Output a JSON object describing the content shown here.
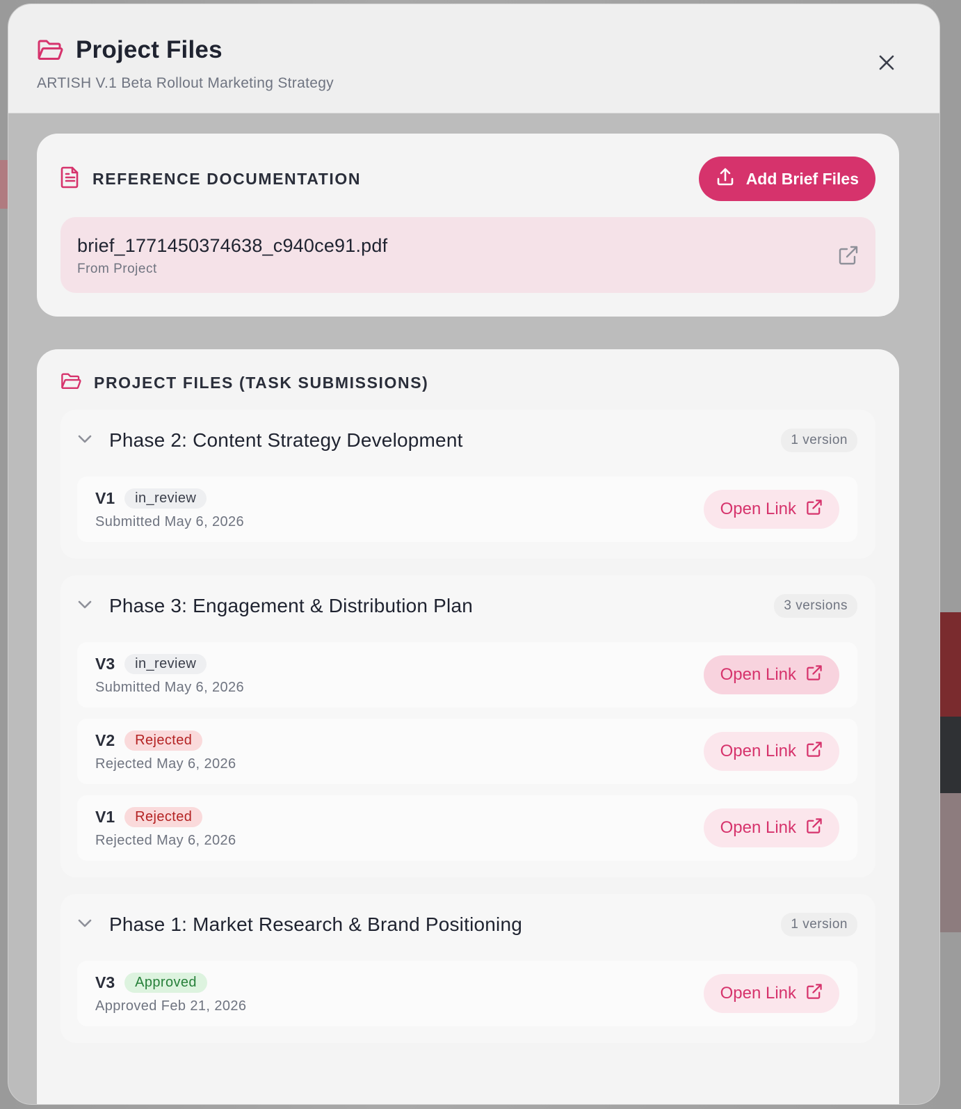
{
  "modal": {
    "title": "Project Files",
    "subtitle": "ARTISH V.1 Beta Rollout Marketing Strategy",
    "close_icon": "close-icon"
  },
  "reference": {
    "section_label": "REFERENCE DOCUMENTATION",
    "add_button_label": "Add Brief Files",
    "file": {
      "name": "brief_1771450374638_c940ce91.pdf",
      "source": "From Project"
    }
  },
  "submissions": {
    "section_label": "PROJECT FILES (TASK SUBMISSIONS)",
    "phases": [
      {
        "title": "Phase 2: Content Strategy Development",
        "count": "1 version",
        "versions": [
          {
            "label": "V1",
            "status": "in_review",
            "date": "Submitted May 6, 2026",
            "link_label": "Open Link"
          }
        ]
      },
      {
        "title": "Phase 3: Engagement & Distribution Plan",
        "count": "3 versions",
        "versions": [
          {
            "label": "V3",
            "status": "in_review",
            "date": "Submitted May 6, 2026",
            "link_label": "Open Link"
          },
          {
            "label": "V2",
            "status": "Rejected",
            "date": "Rejected May 6, 2026",
            "link_label": "Open Link"
          },
          {
            "label": "V1",
            "status": "Rejected",
            "date": "Rejected May 6, 2026",
            "link_label": "Open Link"
          }
        ]
      },
      {
        "title": "Phase 1: Market Research & Brand Positioning",
        "count": "1 version",
        "versions": [
          {
            "label": "V3",
            "status": "Approved",
            "date": "Approved Feb 21, 2026",
            "link_label": "Open Link"
          }
        ]
      }
    ]
  },
  "colors": {
    "accent": "#d6336c",
    "accent_soft": "#fbe6ec",
    "rejected_text": "#b42323",
    "approved_text": "#27803a"
  }
}
